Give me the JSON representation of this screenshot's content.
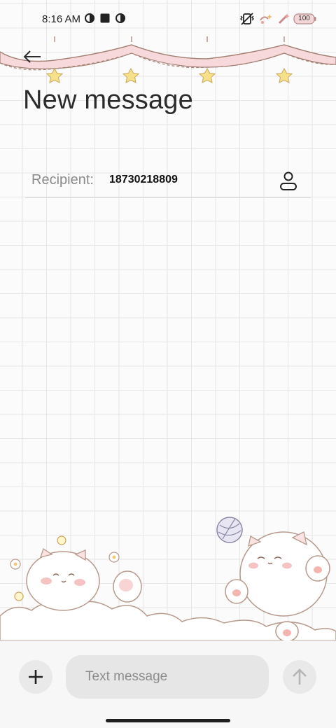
{
  "status_bar": {
    "time": "8:16 AM",
    "battery": "100",
    "icons": [
      "data-saver-icon",
      "stop-square-icon",
      "data-saver-icon",
      "vibrate-icon",
      "sparkle-wifi-icon",
      "sparkle-signal-icon",
      "battery-icon"
    ]
  },
  "header": {
    "back_icon": "arrow-left-icon",
    "title": "New message"
  },
  "recipient": {
    "label": "Recipient:",
    "value": "18730218809",
    "contact_icon": "person-icon"
  },
  "compose": {
    "add_icon": "plus-icon",
    "placeholder": "Text message",
    "send_icon": "arrow-up-icon"
  },
  "theme": {
    "background": "#fbfbfb",
    "grid_line": "#e6e6e6",
    "garland_pink": "#f7d9dc",
    "star_yellow": "#f7e08a",
    "cat_outline": "#b79a8c"
  }
}
